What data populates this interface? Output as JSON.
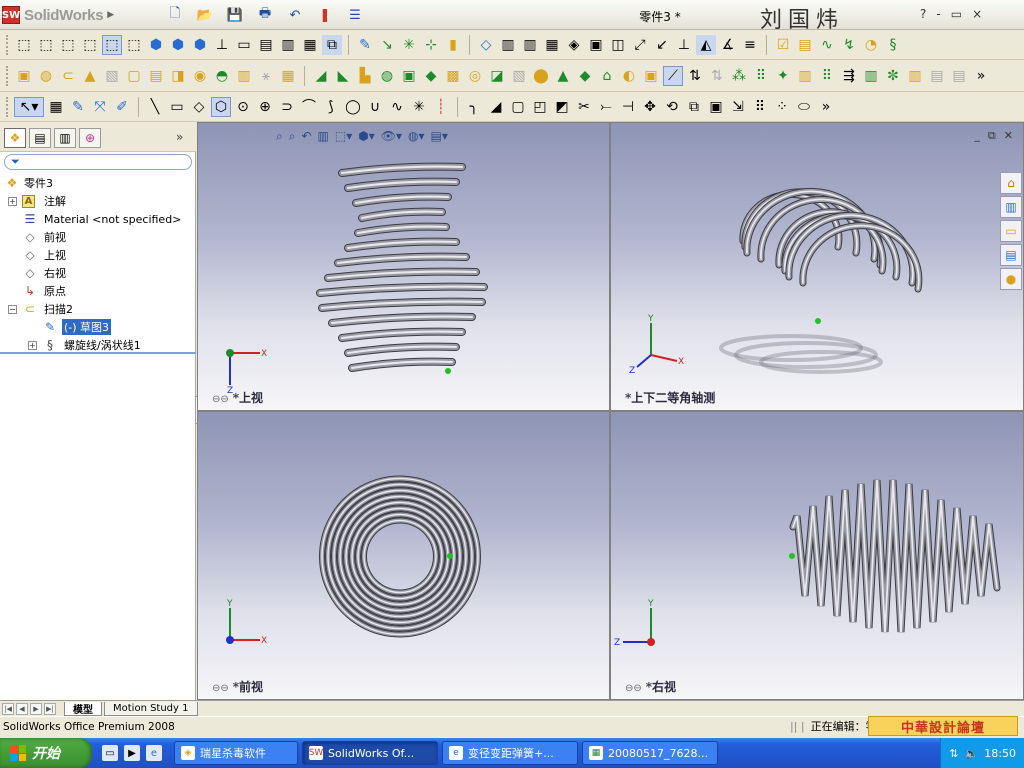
{
  "app": {
    "logo_text": "SolidWorks",
    "doc_title": "零件3 *",
    "signature": "刘国炜",
    "controls": [
      "?",
      "-",
      "▭",
      "×"
    ]
  },
  "featuremanager": {
    "filter_icon": "funnel-icon",
    "tabs": [
      "feature-tree-icon",
      "property-icon",
      "config-icon",
      "display-icon"
    ],
    "items": [
      {
        "label": "零件3",
        "icon": "part-icon"
      },
      {
        "label": "注解",
        "icon": "annotation-icon"
      },
      {
        "label": "Material <not specified>",
        "icon": "material-icon"
      },
      {
        "label": "前视",
        "icon": "plane-icon"
      },
      {
        "label": "上视",
        "icon": "plane-icon"
      },
      {
        "label": "右视",
        "icon": "plane-icon"
      },
      {
        "label": "原点",
        "icon": "origin-icon"
      },
      {
        "label": "扫描2",
        "icon": "sweep-icon"
      },
      {
        "label": "(-) 草图3",
        "icon": "sketch-icon"
      },
      {
        "label": "螺旋线/涡状线1",
        "icon": "helix-icon"
      }
    ]
  },
  "viewports": [
    {
      "label": "*上视"
    },
    {
      "label": "*上下二等角轴测"
    },
    {
      "label": "*前视"
    },
    {
      "label": "*右视"
    }
  ],
  "bottom_tabs": [
    "模型",
    "Motion Study 1"
  ],
  "status": {
    "left": "SolidWorks Office Premium 2008",
    "editing": "正在编辑：零件",
    "watermark": "中華設計論壇"
  },
  "taskbar": {
    "start": "开始",
    "tasks": [
      "瑞星杀毒软件",
      "SolidWorks Of...",
      "变径变距弹簧+...",
      "20080517_7628..."
    ],
    "clock": "18:50"
  }
}
